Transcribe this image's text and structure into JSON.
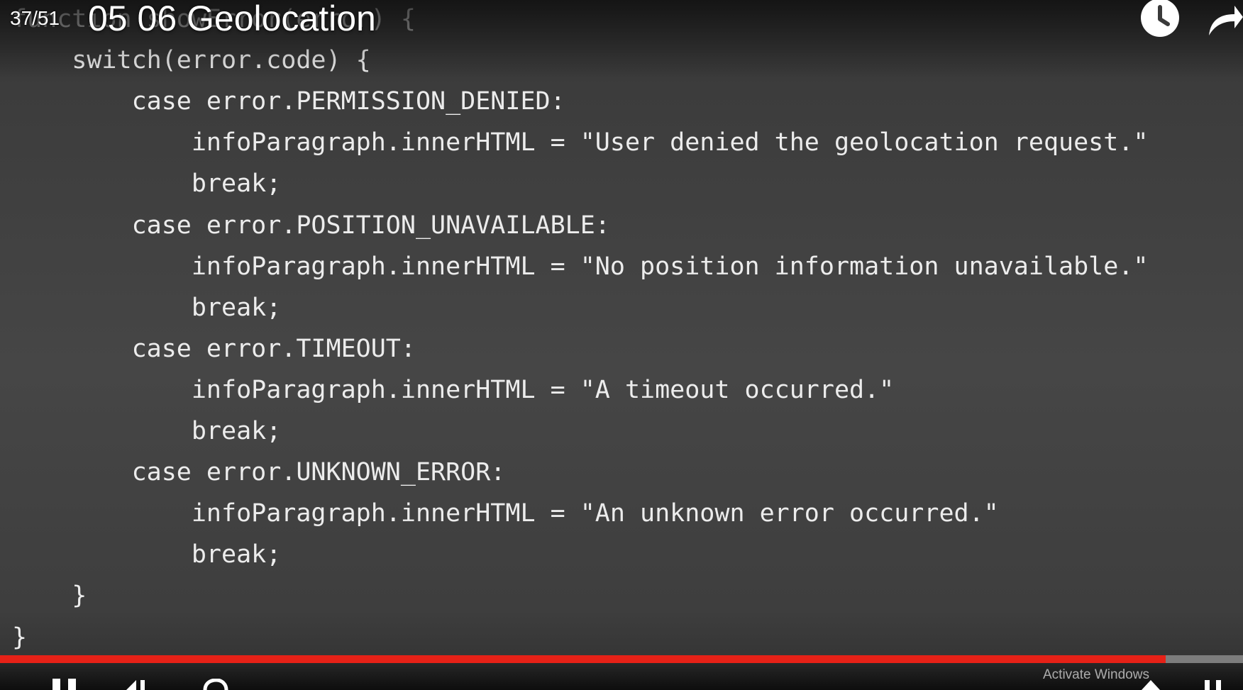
{
  "overlay": {
    "playlist_index": "37/51",
    "title": "05 06 Geolocation"
  },
  "icons": {
    "watch_later": "clock-icon",
    "share": "share-arrow-icon",
    "play_pause": "pause-icon"
  },
  "code": {
    "lines": [
      "function showError(error) {",
      "    switch(error.code) {",
      "        case error.PERMISSION_DENIED:",
      "            infoParagraph.innerHTML = \"User denied the geolocation request.\"",
      "            break;",
      "        case error.POSITION_UNAVAILABLE:",
      "            infoParagraph.innerHTML = \"No position information unavailable.\"",
      "            break;",
      "        case error.TIMEOUT:",
      "            infoParagraph.innerHTML = \"A timeout occurred.\"",
      "            break;",
      "        case error.UNKNOWN_ERROR:",
      "            infoParagraph.innerHTML = \"An unknown error occurred.\"",
      "            break;",
      "    }",
      "}"
    ]
  },
  "progress": {
    "played_fraction": 0.938
  },
  "colors": {
    "progress_played": "#e62117",
    "code_text": "#ececec"
  },
  "watermark": {
    "text": "Activate Windows"
  }
}
